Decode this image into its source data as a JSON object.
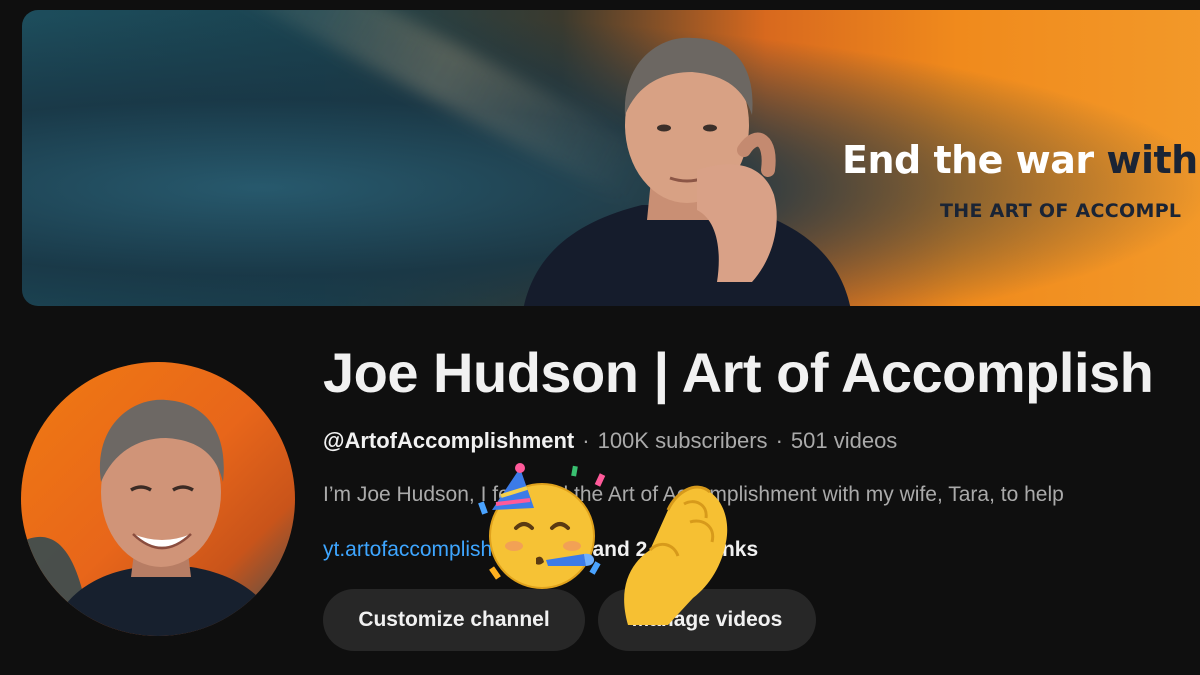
{
  "banner": {
    "headline_light": "End the war ",
    "headline_dark": "with",
    "tagline": "THE ART OF ACCOMPL"
  },
  "channel": {
    "title": "Joe Hudson | Art of Accomplish",
    "handle": "@ArtofAccomplishment",
    "separator": "·",
    "subscribers": "100K subscribers",
    "videos": "501 videos",
    "description": "I’m Joe Hudson, I founded the Art of Accomplishment with my wife, Tara, to help",
    "link": "yt.artofaccomplishment.com",
    "more_links": "and 2 more links"
  },
  "buttons": {
    "customize": "Customize channel",
    "manage": "Manage videos"
  },
  "overlays": {
    "emoji_1": "partying-face-icon",
    "emoji_2": "pinched-fingers-icon"
  },
  "colors": {
    "background": "#0f0f0f",
    "link": "#3ea6ff",
    "button_bg": "#272727",
    "banner_orange": "#f08a1c",
    "banner_teal": "#1d4d5c"
  }
}
